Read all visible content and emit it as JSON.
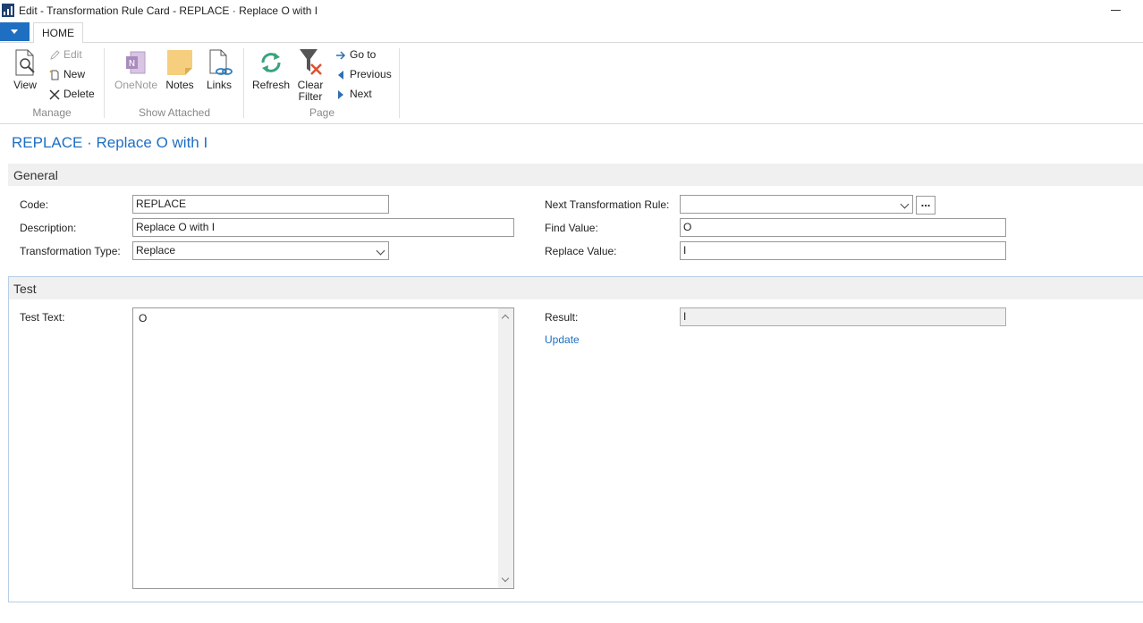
{
  "window": {
    "title": "Edit - Transformation Rule Card - REPLACE · Replace O with I"
  },
  "ribbon": {
    "tab": "HOME",
    "manage": {
      "label": "Manage",
      "view": "View",
      "edit": "Edit",
      "new": "New",
      "delete": "Delete"
    },
    "show_attached": {
      "label": "Show Attached",
      "onenote": "OneNote",
      "notes": "Notes",
      "links": "Links"
    },
    "page": {
      "label": "Page",
      "refresh": "Refresh",
      "clear_filter_1": "Clear",
      "clear_filter_2": "Filter",
      "go_to": "Go to",
      "previous": "Previous",
      "next": "Next"
    }
  },
  "page_title": "REPLACE · Replace O with I",
  "general": {
    "header": "General",
    "code_label": "Code:",
    "code_value": "REPLACE",
    "description_label": "Description:",
    "description_value": "Replace O with I",
    "type_label": "Transformation Type:",
    "type_value": "Replace",
    "next_rule_label": "Next Transformation Rule:",
    "next_rule_value": "",
    "find_label": "Find Value:",
    "find_value": "O",
    "replace_label": "Replace Value:",
    "replace_value": "I",
    "ellipsis": "..."
  },
  "test": {
    "header": "Test",
    "text_label": "Test Text:",
    "text_value": "O",
    "result_label": "Result:",
    "result_value": "I",
    "update": "Update"
  },
  "colors": {
    "accent": "#1e6fc2",
    "section_bg": "#f0f0f0"
  }
}
